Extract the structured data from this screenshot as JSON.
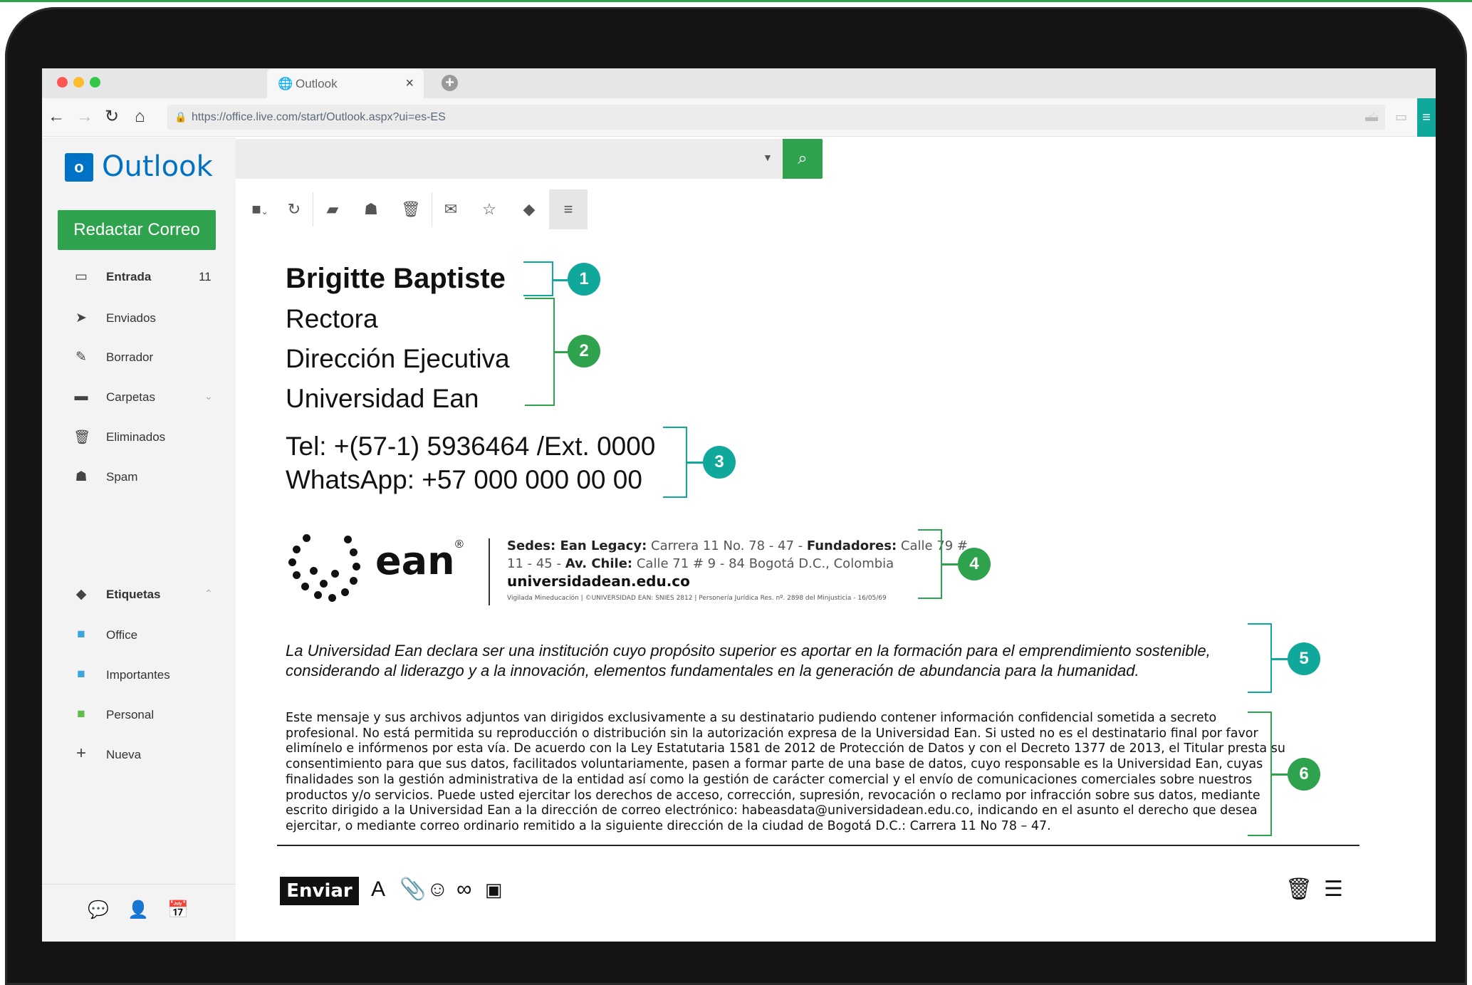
{
  "browser": {
    "tab_title": "Outlook",
    "url": "https://office.live.com/start/Outlook.aspx?ui=es-ES"
  },
  "app": {
    "logo_text": "Outlook",
    "logo_letter": "o",
    "compose_label": "Redactar Correo",
    "search_placeholder": ""
  },
  "sidebar": {
    "items": [
      {
        "label": "Entrada",
        "count": "11",
        "icon": "inbox-icon"
      },
      {
        "label": "Enviados",
        "icon": "send-icon"
      },
      {
        "label": "Borrador",
        "icon": "pencil-icon"
      },
      {
        "label": "Carpetas",
        "icon": "folder-icon"
      },
      {
        "label": "Eliminados",
        "icon": "trash-icon"
      },
      {
        "label": "Spam",
        "icon": "ghost-icon"
      }
    ],
    "labels_header": "Etiquetas",
    "labels": [
      {
        "label": "Office",
        "color": "#3aa6dd"
      },
      {
        "label": "Importantes",
        "color": "#3aa6dd"
      },
      {
        "label": "Personal",
        "color": "#5fbe4a"
      }
    ],
    "new_label": "Nueva"
  },
  "signature": {
    "name": "Brigitte Baptiste",
    "title": "Rectora",
    "department": "Dirección Ejecutiva",
    "institution": "Universidad Ean",
    "phone": "Tel: +(57-1) 5936464 /Ext. 0000",
    "whatsapp": "WhatsApp: +57 000 000 00 00",
    "logo_word": "ean",
    "logo_reg": "®",
    "sedes_label": "Sedes: Ean Legacy:",
    "sedes_value": " Carrera 11 No. 78 - 47 - ",
    "fundadores_label": "Fundadores:",
    "fundadores_value": " Calle 79 #",
    "line2_start": "11 - 45 - ",
    "chile_label": "Av. Chile:",
    "chile_value": " Calle 71 # 9 - 84 Bogotá D.C., Colombia",
    "website": "universidadean.edu.co",
    "legal_small": "Vigilada Mineducación | ©UNIVERSIDAD EAN: SNIES 2812 | Personería Jurídica Res. nº. 2898 del Minjusticia - 16/05/69",
    "purpose": [
      "La Universidad Ean declara ser una institución cuyo propósito superior es aportar en la formación para el emprendimiento sostenible,",
      "considerando al liderazgo y a la innovación, elementos fundamentales en la generación de abundancia para la humanidad."
    ],
    "disclaimer": [
      "Este mensaje y sus archivos adjuntos van dirigidos exclusivamente a su destinatario pudiendo contener información confidencial sometida a secreto",
      "profesional. No está permitida su reproducción o distribución sin la autorización expresa de la Universidad Ean. Si usted no es el destinatario final por favor",
      "elimínelo e infórmenos por esta vía. De acuerdo con la Ley Estatutaria 1581 de 2012 de Protección de Datos y con el Decreto 1377 de 2013, el Titular presta su",
      "consentimiento para que sus datos, facilitados voluntariamente, pasen a formar parte de una base de datos, cuyo responsable es la Universidad Ean, cuyas",
      "finalidades son la gestión administrativa de la entidad así como la gestión de carácter comercial y el envío de comunicaciones comerciales sobre nuestros",
      "productos y/o servicios. Puede usted ejercitar los derechos de acceso, corrección, supresión, revocación o reclamo por infracción sobre sus datos, mediante",
      "escrito dirigido a la Universidad Ean a la dirección de correo electrónico: habeasdata@universidadean.edu.co, indicando en el asunto el derecho que desea",
      "ejercitar, o mediante correo ordinario remitido a la siguiente dirección de la ciudad de Bogotá D.C.: Carrera 11 No 78 – 47."
    ]
  },
  "markers": [
    "1",
    "2",
    "3",
    "4",
    "5",
    "6"
  ],
  "composer": {
    "send_label": "Enviar",
    "format_glyph": "A"
  },
  "colors": {
    "brand_green": "#2ea24c",
    "teal": "#10a89a",
    "outlook_blue": "#0072c6"
  }
}
